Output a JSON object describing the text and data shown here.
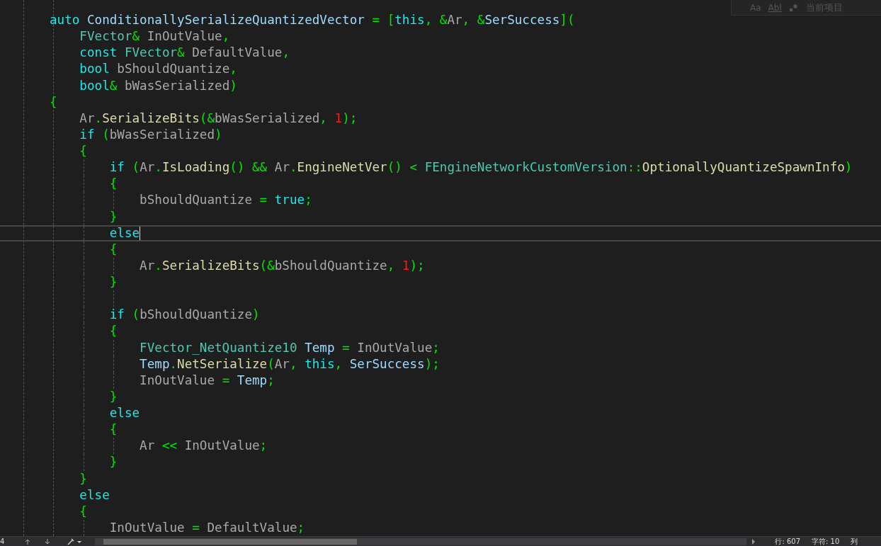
{
  "find_widget": {
    "case_option": "Aa",
    "word_option": "Abl",
    "scope": "当前项目"
  },
  "editor": {
    "lines": [
      {
        "current": false,
        "tokens": [
          {
            "kind": "kw",
            "text": "auto "
          },
          {
            "kind": "local",
            "text": "ConditionallySerializeQuantizedVector"
          },
          {
            "kind": "punct",
            "text": " = ["
          },
          {
            "kind": "kw",
            "text": "this"
          },
          {
            "kind": "punct",
            "text": ", &"
          },
          {
            "kind": "var",
            "text": "Ar"
          },
          {
            "kind": "punct",
            "text": ", &"
          },
          {
            "kind": "local",
            "text": "SerSuccess"
          },
          {
            "kind": "punct",
            "text": "]("
          }
        ]
      },
      {
        "current": false,
        "tokens": [
          {
            "kind": "type",
            "text": "    FVector"
          },
          {
            "kind": "punct",
            "text": "& "
          },
          {
            "kind": "var",
            "text": "InOutValue"
          },
          {
            "kind": "punct",
            "text": ","
          }
        ]
      },
      {
        "current": false,
        "tokens": [
          {
            "kind": "kw",
            "text": "    const "
          },
          {
            "kind": "type",
            "text": "FVector"
          },
          {
            "kind": "punct",
            "text": "& "
          },
          {
            "kind": "var",
            "text": "DefaultValue"
          },
          {
            "kind": "punct",
            "text": ","
          }
        ]
      },
      {
        "current": false,
        "tokens": [
          {
            "kind": "kw",
            "text": "    bool "
          },
          {
            "kind": "var",
            "text": "bShouldQuantize"
          },
          {
            "kind": "punct",
            "text": ","
          }
        ]
      },
      {
        "current": false,
        "tokens": [
          {
            "kind": "kw",
            "text": "    bool"
          },
          {
            "kind": "punct",
            "text": "& "
          },
          {
            "kind": "var",
            "text": "bWasSerialized"
          },
          {
            "kind": "punct",
            "text": ")"
          }
        ]
      },
      {
        "current": false,
        "tokens": [
          {
            "kind": "punct",
            "text": "{"
          }
        ]
      },
      {
        "current": false,
        "tokens": [
          {
            "kind": "var",
            "text": "    Ar"
          },
          {
            "kind": "punct",
            "text": "."
          },
          {
            "kind": "func",
            "text": "SerializeBits"
          },
          {
            "kind": "punct",
            "text": "(&"
          },
          {
            "kind": "var",
            "text": "bWasSerialized"
          },
          {
            "kind": "punct",
            "text": ", "
          },
          {
            "kind": "num",
            "text": "1"
          },
          {
            "kind": "punct",
            "text": ");"
          }
        ]
      },
      {
        "current": false,
        "tokens": [
          {
            "kind": "kw",
            "text": "    if "
          },
          {
            "kind": "punct",
            "text": "("
          },
          {
            "kind": "var",
            "text": "bWasSerialized"
          },
          {
            "kind": "punct",
            "text": ")"
          }
        ]
      },
      {
        "current": false,
        "tokens": [
          {
            "kind": "punct",
            "text": "    {"
          }
        ]
      },
      {
        "current": false,
        "tokens": [
          {
            "kind": "kw",
            "text": "        if "
          },
          {
            "kind": "punct",
            "text": "("
          },
          {
            "kind": "var",
            "text": "Ar"
          },
          {
            "kind": "punct",
            "text": "."
          },
          {
            "kind": "func",
            "text": "IsLoading"
          },
          {
            "kind": "punct",
            "text": "() && "
          },
          {
            "kind": "var",
            "text": "Ar"
          },
          {
            "kind": "punct",
            "text": "."
          },
          {
            "kind": "func",
            "text": "EngineNetVer"
          },
          {
            "kind": "punct",
            "text": "() < "
          },
          {
            "kind": "type",
            "text": "FEngineNetworkCustomVersion"
          },
          {
            "kind": "punct",
            "text": "::"
          },
          {
            "kind": "func",
            "text": "OptionallyQuantizeSpawnInfo"
          },
          {
            "kind": "punct",
            "text": ")"
          }
        ]
      },
      {
        "current": false,
        "tokens": [
          {
            "kind": "punct",
            "text": "        {"
          }
        ]
      },
      {
        "current": false,
        "tokens": [
          {
            "kind": "var",
            "text": "            bShouldQuantize"
          },
          {
            "kind": "punct",
            "text": " = "
          },
          {
            "kind": "kw",
            "text": "true"
          },
          {
            "kind": "punct",
            "text": ";"
          }
        ]
      },
      {
        "current": false,
        "tokens": [
          {
            "kind": "punct",
            "text": "        }"
          }
        ]
      },
      {
        "current": true,
        "tokens": [
          {
            "kind": "kw",
            "text": "        else"
          }
        ]
      },
      {
        "current": false,
        "tokens": [
          {
            "kind": "punct",
            "text": "        {"
          }
        ]
      },
      {
        "current": false,
        "tokens": [
          {
            "kind": "var",
            "text": "            Ar"
          },
          {
            "kind": "punct",
            "text": "."
          },
          {
            "kind": "func",
            "text": "SerializeBits"
          },
          {
            "kind": "punct",
            "text": "(&"
          },
          {
            "kind": "var",
            "text": "bShouldQuantize"
          },
          {
            "kind": "punct",
            "text": ", "
          },
          {
            "kind": "num",
            "text": "1"
          },
          {
            "kind": "punct",
            "text": ");"
          }
        ]
      },
      {
        "current": false,
        "tokens": [
          {
            "kind": "punct",
            "text": "        }"
          }
        ]
      },
      {
        "current": false
      },
      {
        "current": false,
        "tokens": [
          {
            "kind": "kw",
            "text": "        if "
          },
          {
            "kind": "punct",
            "text": "("
          },
          {
            "kind": "var",
            "text": "bShouldQuantize"
          },
          {
            "kind": "punct",
            "text": ")"
          }
        ]
      },
      {
        "current": false,
        "tokens": [
          {
            "kind": "punct",
            "text": "        {"
          }
        ]
      },
      {
        "current": false,
        "tokens": [
          {
            "kind": "type",
            "text": "            FVector_NetQuantize10 "
          },
          {
            "kind": "local",
            "text": "Temp"
          },
          {
            "kind": "punct",
            "text": " = "
          },
          {
            "kind": "var",
            "text": "InOutValue"
          },
          {
            "kind": "punct",
            "text": ";"
          }
        ]
      },
      {
        "current": false,
        "tokens": [
          {
            "kind": "local",
            "text": "            Temp"
          },
          {
            "kind": "punct",
            "text": "."
          },
          {
            "kind": "func",
            "text": "NetSerialize"
          },
          {
            "kind": "punct",
            "text": "("
          },
          {
            "kind": "var",
            "text": "Ar"
          },
          {
            "kind": "punct",
            "text": ", "
          },
          {
            "kind": "kw",
            "text": "this"
          },
          {
            "kind": "punct",
            "text": ", "
          },
          {
            "kind": "local",
            "text": "SerSuccess"
          },
          {
            "kind": "punct",
            "text": ");"
          }
        ]
      },
      {
        "current": false,
        "tokens": [
          {
            "kind": "var",
            "text": "            InOutValue"
          },
          {
            "kind": "punct",
            "text": " = "
          },
          {
            "kind": "local",
            "text": "Temp"
          },
          {
            "kind": "punct",
            "text": ";"
          }
        ]
      },
      {
        "current": false,
        "tokens": [
          {
            "kind": "punct",
            "text": "        }"
          }
        ]
      },
      {
        "current": false,
        "tokens": [
          {
            "kind": "kw",
            "text": "        else"
          }
        ]
      },
      {
        "current": false,
        "tokens": [
          {
            "kind": "punct",
            "text": "        {"
          }
        ]
      },
      {
        "current": false,
        "tokens": [
          {
            "kind": "var",
            "text": "            Ar"
          },
          {
            "kind": "punct",
            "text": " << "
          },
          {
            "kind": "var",
            "text": "InOutValue"
          },
          {
            "kind": "punct",
            "text": ";"
          }
        ]
      },
      {
        "current": false,
        "tokens": [
          {
            "kind": "punct",
            "text": "        }"
          }
        ]
      },
      {
        "current": false,
        "tokens": [
          {
            "kind": "punct",
            "text": "    }"
          }
        ]
      },
      {
        "current": false,
        "tokens": [
          {
            "kind": "kw",
            "text": "    else"
          }
        ]
      },
      {
        "current": false,
        "tokens": [
          {
            "kind": "punct",
            "text": "    {"
          }
        ]
      },
      {
        "current": false,
        "tokens": [
          {
            "kind": "var",
            "text": "        InOutValue"
          },
          {
            "kind": "punct",
            "text": " = "
          },
          {
            "kind": "var",
            "text": "DefaultValue"
          },
          {
            "kind": "punct",
            "text": ";"
          }
        ]
      }
    ]
  },
  "status_bar": {
    "zoom": "4",
    "line": "行: 607",
    "char": "字符: 10",
    "col": "列"
  }
}
